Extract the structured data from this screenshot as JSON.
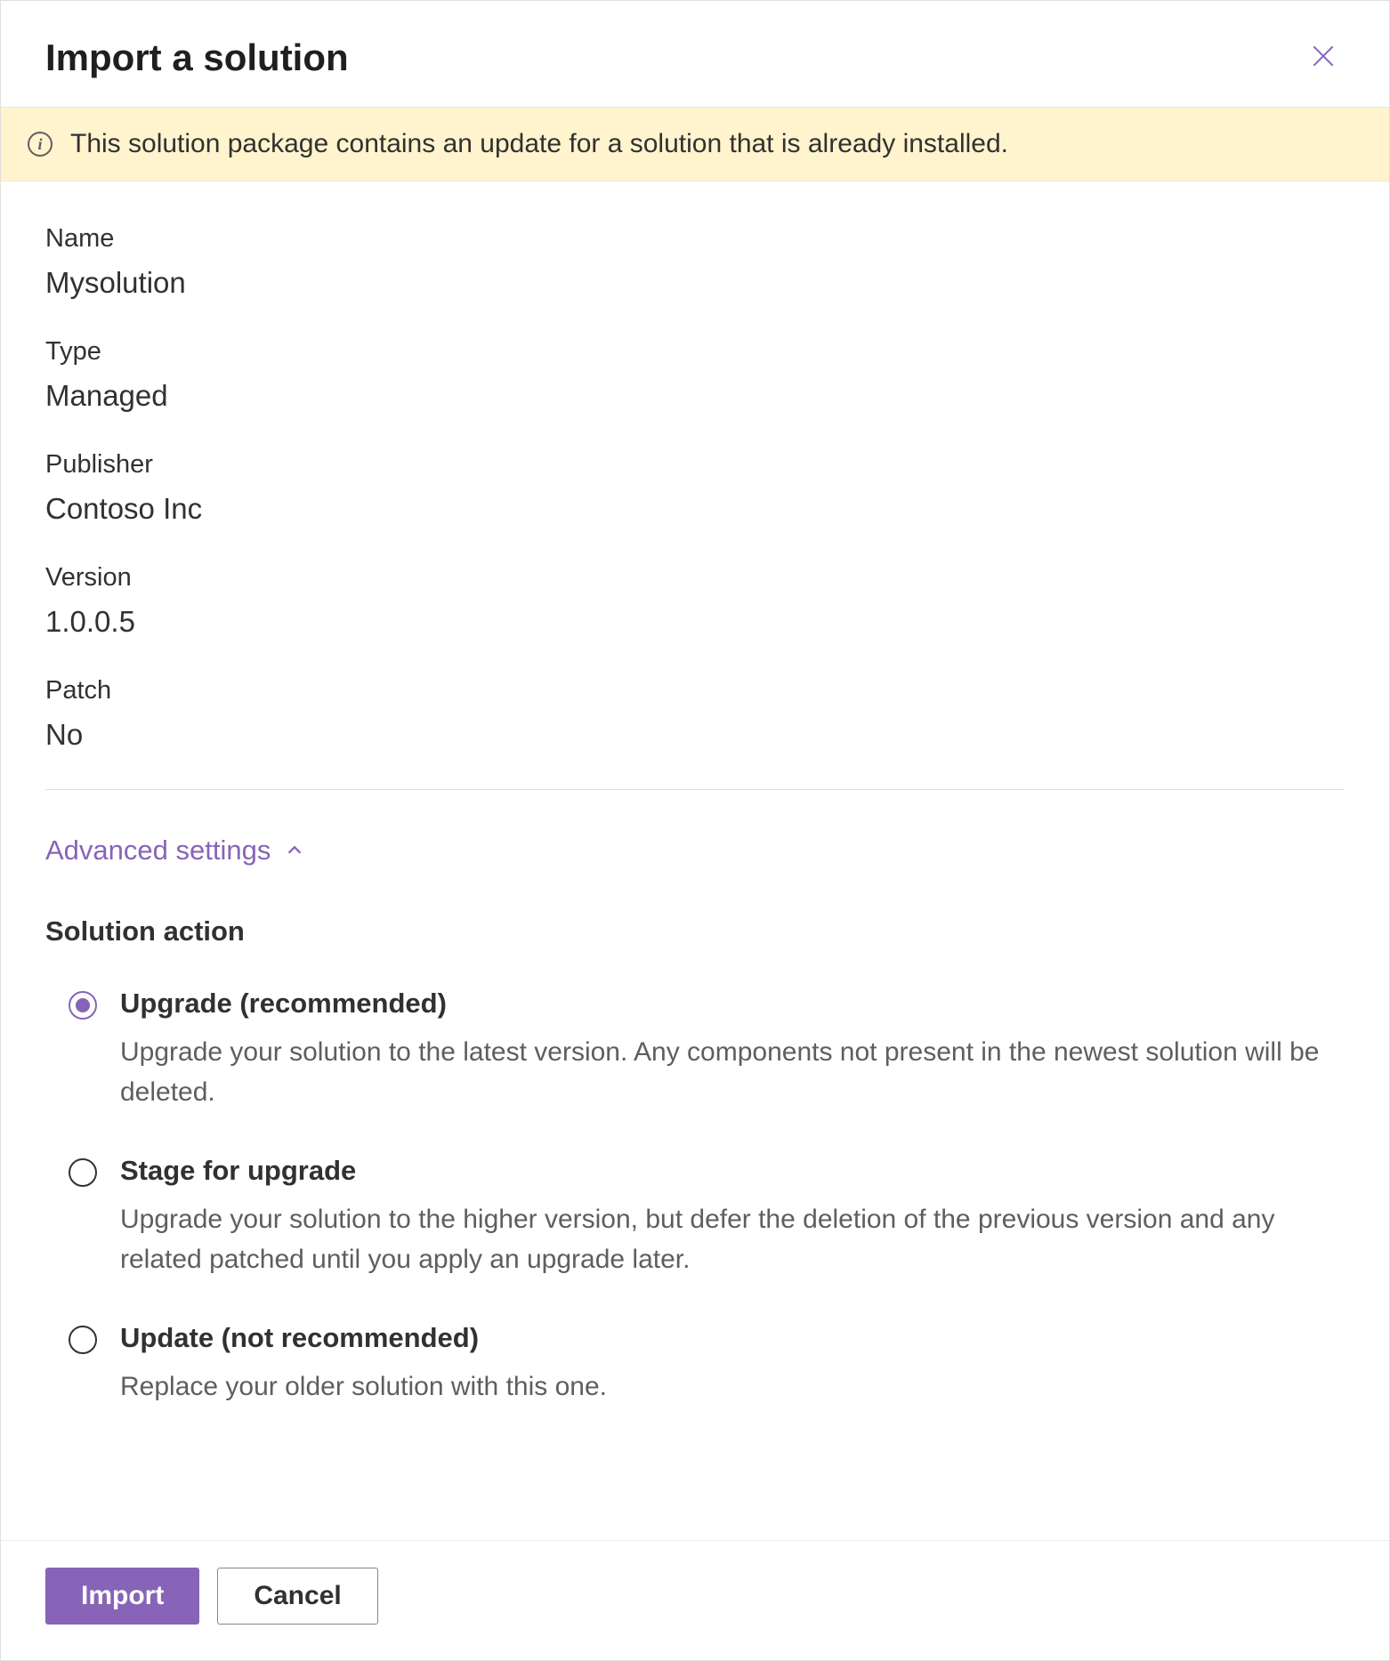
{
  "header": {
    "title": "Import a solution"
  },
  "banner": {
    "message": "This solution package contains an update for a solution that is already installed."
  },
  "fields": {
    "name": {
      "label": "Name",
      "value": "Mysolution"
    },
    "type": {
      "label": "Type",
      "value": "Managed"
    },
    "publisher": {
      "label": "Publisher",
      "value": "Contoso Inc"
    },
    "version": {
      "label": "Version",
      "value": "1.0.0.5"
    },
    "patch": {
      "label": "Patch",
      "value": "No"
    }
  },
  "advanced": {
    "toggle_label": "Advanced settings",
    "section_title": "Solution action",
    "options": [
      {
        "label": "Upgrade (recommended)",
        "description": "Upgrade your solution to the latest version. Any components not present in the newest solution will be deleted.",
        "selected": true
      },
      {
        "label": "Stage for upgrade",
        "description": "Upgrade your solution to the higher version, but defer the deletion of the previous version and any related patched until you apply an upgrade later.",
        "selected": false
      },
      {
        "label": "Update (not recommended)",
        "description": "Replace your older solution with this one.",
        "selected": false
      }
    ]
  },
  "footer": {
    "import_label": "Import",
    "cancel_label": "Cancel"
  },
  "colors": {
    "accent": "#8764b8",
    "banner_bg": "#fff4ce"
  }
}
